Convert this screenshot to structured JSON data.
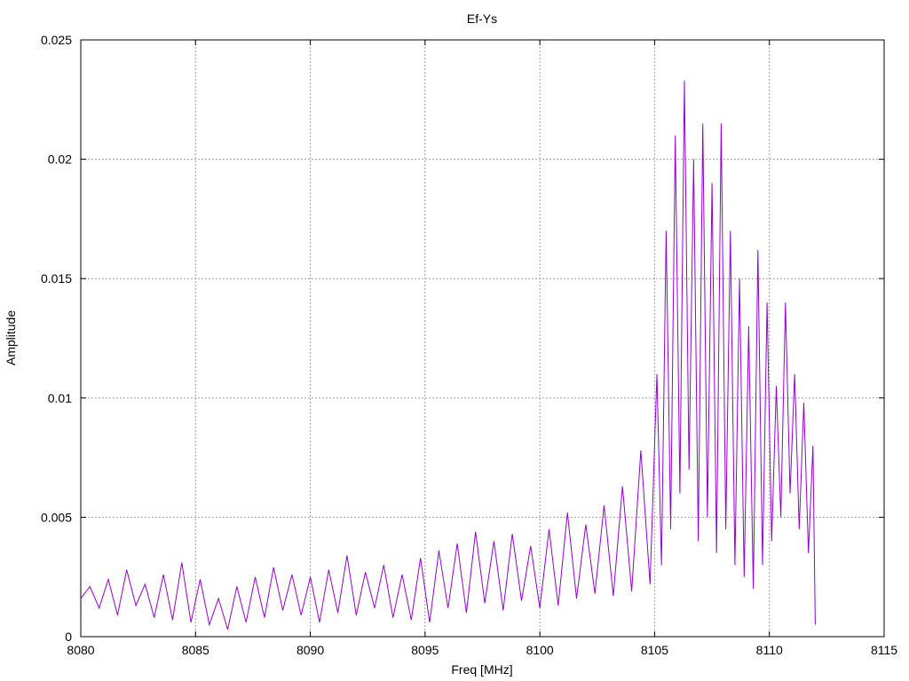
{
  "chart_data": {
    "type": "line",
    "title": "Ef-Ys",
    "xlabel": "Freq [MHz]",
    "ylabel": "Amplitude",
    "xlim": [
      8080,
      8115
    ],
    "ylim": [
      0,
      0.025
    ],
    "x_ticks": [
      8080,
      8085,
      8090,
      8095,
      8100,
      8105,
      8110,
      8115
    ],
    "y_ticks": [
      0,
      0.005,
      0.01,
      0.015,
      0.02,
      0.025
    ],
    "x_tick_labels": [
      "8080",
      "8085",
      "8090",
      "8095",
      "8100",
      "8105",
      "8110",
      "8115"
    ],
    "y_tick_labels": [
      "0",
      "0.005",
      "0.01",
      "0.015",
      "0.02",
      "0.025"
    ],
    "grid": true,
    "series": [
      {
        "color": "#9400d3",
        "x": [
          8080.0,
          8080.4,
          8080.8,
          8081.2,
          8081.6,
          8082.0,
          8082.4,
          8082.8,
          8083.2,
          8083.6,
          8084.0,
          8084.4,
          8084.8,
          8085.2,
          8085.6,
          8086.0,
          8086.4,
          8086.8,
          8087.2,
          8087.6,
          8088.0,
          8088.4,
          8088.8,
          8089.2,
          8089.6,
          8090.0,
          8090.4,
          8090.8,
          8091.2,
          8091.6,
          8092.0,
          8092.4,
          8092.8,
          8093.2,
          8093.6,
          8094.0,
          8094.4,
          8094.8,
          8095.2,
          8095.6,
          8096.0,
          8096.4,
          8096.8,
          8097.2,
          8097.6,
          8098.0,
          8098.4,
          8098.8,
          8099.2,
          8099.6,
          8100.0,
          8100.4,
          8100.8,
          8101.2,
          8101.6,
          8102.0,
          8102.4,
          8102.8,
          8103.2,
          8103.6,
          8104.0,
          8104.4,
          8104.8,
          8105.1,
          8105.3,
          8105.5,
          8105.7,
          8105.9,
          8106.1,
          8106.3,
          8106.5,
          8106.7,
          8106.9,
          8107.1,
          8107.3,
          8107.5,
          8107.7,
          8107.9,
          8108.1,
          8108.3,
          8108.5,
          8108.7,
          8108.9,
          8109.1,
          8109.3,
          8109.5,
          8109.7,
          8109.9,
          8110.1,
          8110.3,
          8110.5,
          8110.7,
          8110.9,
          8111.1,
          8111.3,
          8111.5,
          8111.7,
          8111.9,
          8112.0
        ],
        "values": [
          0.0016,
          0.0021,
          0.0012,
          0.0024,
          0.0009,
          0.0028,
          0.0013,
          0.0022,
          0.0008,
          0.0026,
          0.0007,
          0.0031,
          0.0006,
          0.0024,
          0.0005,
          0.0016,
          0.0003,
          0.0021,
          0.0006,
          0.0025,
          0.0008,
          0.0029,
          0.0011,
          0.0026,
          0.0009,
          0.0025,
          0.0006,
          0.0028,
          0.001,
          0.0034,
          0.0009,
          0.0027,
          0.0012,
          0.003,
          0.0008,
          0.0026,
          0.0007,
          0.0033,
          0.0006,
          0.0036,
          0.0012,
          0.0039,
          0.001,
          0.0044,
          0.0014,
          0.004,
          0.0011,
          0.0043,
          0.0015,
          0.0038,
          0.0012,
          0.0045,
          0.0013,
          0.0052,
          0.0016,
          0.0047,
          0.0018,
          0.0055,
          0.0017,
          0.0063,
          0.0019,
          0.0078,
          0.0022,
          0.011,
          0.003,
          0.017,
          0.0045,
          0.021,
          0.006,
          0.0233,
          0.007,
          0.02,
          0.004,
          0.0215,
          0.005,
          0.019,
          0.0035,
          0.0215,
          0.0045,
          0.017,
          0.003,
          0.015,
          0.0025,
          0.013,
          0.002,
          0.0162,
          0.003,
          0.014,
          0.004,
          0.0105,
          0.005,
          0.014,
          0.006,
          0.011,
          0.0045,
          0.0098,
          0.0035,
          0.008,
          0.0005
        ]
      }
    ]
  }
}
